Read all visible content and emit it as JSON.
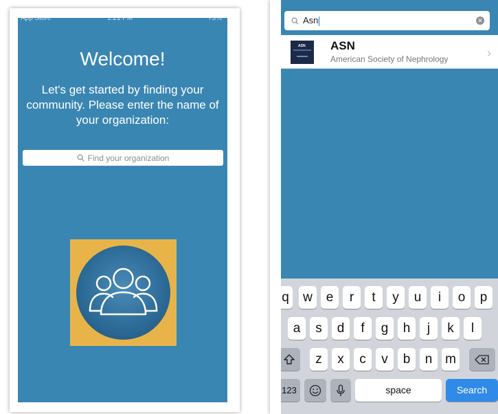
{
  "left": {
    "status_bar": {
      "left": "App Store",
      "time": "1:21 PM",
      "right": "75%"
    },
    "title": "Welcome!",
    "intro_text": "Let's get started by finding your community.  Please enter the name of your organization:",
    "search_placeholder": "Find your organization",
    "icon": "community-group-icon",
    "colors": {
      "background": "#3a86b3",
      "logo_bg": "#e8b44a"
    }
  },
  "right": {
    "search": {
      "value": "Asn"
    },
    "results": [
      {
        "title": "ASN",
        "subtitle": "American Society of Nephrology",
        "thumb_text": "ASN"
      }
    ],
    "keyboard": {
      "row1": [
        "q",
        "w",
        "e",
        "r",
        "t",
        "y",
        "u",
        "i",
        "o",
        "p"
      ],
      "row2": [
        "a",
        "s",
        "d",
        "f",
        "g",
        "h",
        "j",
        "k",
        "l"
      ],
      "row3": [
        "z",
        "x",
        "c",
        "v",
        "b",
        "n",
        "m"
      ],
      "numbers_key": "123",
      "space_key": "space",
      "search_key": "Search"
    }
  }
}
